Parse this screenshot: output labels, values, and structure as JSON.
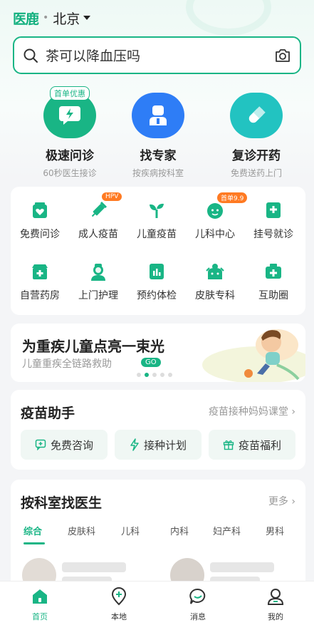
{
  "header": {
    "logo": "医鹿",
    "city": "北京"
  },
  "search": {
    "text": "茶可以降血压吗"
  },
  "quick": [
    {
      "title": "极速问诊",
      "sub": "60秒医生接诊",
      "badge": "首单优惠"
    },
    {
      "title": "找专家",
      "sub": "按疾病按科室",
      "badge": ""
    },
    {
      "title": "复诊开药",
      "sub": "免费送药上门",
      "badge": ""
    }
  ],
  "services": [
    {
      "label": "免费问诊",
      "tag": ""
    },
    {
      "label": "成人疫苗",
      "tag": "HPV"
    },
    {
      "label": "儿童疫苗",
      "tag": ""
    },
    {
      "label": "儿科中心",
      "tag": "首单9.9"
    },
    {
      "label": "挂号就诊",
      "tag": ""
    },
    {
      "label": "自营药房",
      "tag": ""
    },
    {
      "label": "上门护理",
      "tag": ""
    },
    {
      "label": "预约体检",
      "tag": ""
    },
    {
      "label": "皮肤专科",
      "tag": ""
    },
    {
      "label": "互助圈",
      "tag": ""
    }
  ],
  "banner": {
    "title": "为重疾儿童点亮一束光",
    "subtitle": "儿童重疾全链路救助",
    "go": "GO"
  },
  "vaccine": {
    "title": "疫苗助手",
    "more": "疫苗接种妈妈课堂",
    "buttons": [
      "免费咨询",
      "接种计划",
      "疫苗福利"
    ]
  },
  "department": {
    "title": "按科室找医生",
    "more": "更多",
    "tabs": [
      "综合",
      "皮肤科",
      "儿科",
      "内科",
      "妇产科",
      "男科"
    ]
  },
  "tabbar": [
    "首页",
    "本地",
    "消息",
    "我的"
  ],
  "colors": {
    "accent": "#19b585",
    "orange": "#ff7a22"
  }
}
